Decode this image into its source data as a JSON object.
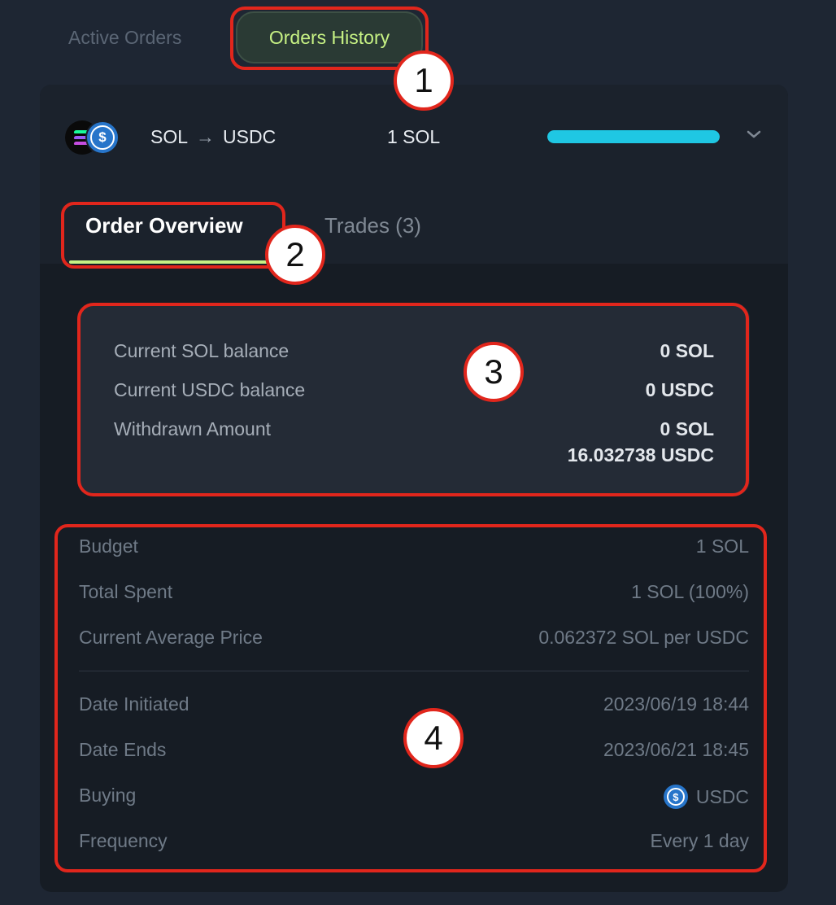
{
  "top_tabs": {
    "active_orders": "Active Orders",
    "orders_history": "Orders History"
  },
  "order": {
    "from_token": "SOL",
    "to_token": "USDC",
    "amount": "1 SOL",
    "progress_fraction": 1.0,
    "progress_color": "#1fc7e3"
  },
  "sub_tabs": {
    "overview": "Order Overview",
    "trades": "Trades (3)"
  },
  "balances": [
    {
      "label": "Current SOL balance",
      "value": "0 SOL",
      "value2": ""
    },
    {
      "label": "Current USDC balance",
      "value": "0 USDC",
      "value2": ""
    },
    {
      "label": "Withdrawn Amount",
      "value": "0 SOL",
      "value2": "16.032738 USDC"
    }
  ],
  "details": [
    {
      "label": "Budget",
      "value": "1 SOL"
    },
    {
      "label": "Total Spent",
      "value": "1 SOL (100%)"
    },
    {
      "label": "Current Average Price",
      "value": "0.062372 SOL per USDC"
    },
    {
      "label": "Date Initiated",
      "value": "2023/06/19 18:44"
    },
    {
      "label": "Date Ends",
      "value": "2023/06/21 18:45"
    },
    {
      "label": "Buying",
      "value": "USDC",
      "icon": "usdc-icon"
    },
    {
      "label": "Frequency",
      "value": "Every 1 day"
    }
  ],
  "markers": [
    "1",
    "2",
    "3",
    "4"
  ],
  "colors": {
    "accent": "#c7f284",
    "highlight": "#e1261c",
    "usdc": "#2775ca"
  }
}
